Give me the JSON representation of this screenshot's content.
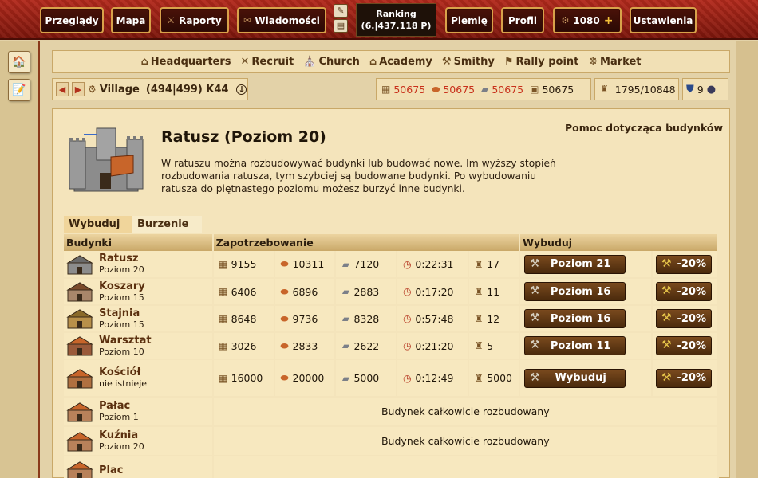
{
  "topbar": {
    "buttons": [
      {
        "label": "Przeglądy"
      },
      {
        "label": "Mapa"
      },
      {
        "label": "Raporty"
      },
      {
        "label": "Wiadomości"
      },
      {
        "label": "Plemię"
      },
      {
        "label": "Profil"
      },
      {
        "label": "1080"
      },
      {
        "label": "Ustawienia"
      }
    ],
    "ranking_label": "Ranking",
    "ranking_value": "(6.|437.118 P)"
  },
  "building_nav": [
    {
      "label": "Headquarters",
      "icon": "headquarters-icon"
    },
    {
      "label": "Recruit",
      "icon": "crossed-swords-icon"
    },
    {
      "label": "Church",
      "icon": "church-icon"
    },
    {
      "label": "Academy",
      "icon": "academy-icon"
    },
    {
      "label": "Smithy",
      "icon": "anvil-icon"
    },
    {
      "label": "Rally point",
      "icon": "flag-icon"
    },
    {
      "label": "Market",
      "icon": "wheel-icon"
    }
  ],
  "village": {
    "name": "Village",
    "coords": "(494|499) K44"
  },
  "resources": {
    "wood": "50675",
    "clay": "50675",
    "iron": "50675",
    "storage": "50675",
    "population": "1795/10848",
    "units": "9"
  },
  "page": {
    "title": "Ratusz (Poziom 20)",
    "help_link": "Pomoc dotycząca budynków",
    "description": "W ratuszu można rozbudowywać budynki lub budować nowe. Im wyższy stopień rozbudowania ratusza, tym szybciej są budowane budynki. Po wybudowaniu ratusza do piętnastego poziomu możesz burzyć inne budynki."
  },
  "tabs": [
    {
      "label": "Wybuduj"
    },
    {
      "label": "Burzenie"
    }
  ],
  "table": {
    "headers": {
      "buildings": "Budynki",
      "requirements": "Zapotrzebowanie",
      "build": "Wybuduj"
    },
    "rows": [
      {
        "name": "Ratusz",
        "level": "Poziom 20",
        "wood": "9155",
        "clay": "10311",
        "iron": "7120",
        "time": "0:22:31",
        "pop": "17",
        "button": "Poziom 21",
        "discount": "-20%"
      },
      {
        "name": "Koszary",
        "level": "Poziom 15",
        "wood": "6406",
        "clay": "6896",
        "iron": "2883",
        "time": "0:17:20",
        "pop": "11",
        "button": "Poziom 16",
        "discount": "-20%"
      },
      {
        "name": "Stajnia",
        "level": "Poziom 15",
        "wood": "8648",
        "clay": "9736",
        "iron": "8328",
        "time": "0:57:48",
        "pop": "12",
        "button": "Poziom 16",
        "discount": "-20%"
      },
      {
        "name": "Warsztat",
        "level": "Poziom 10",
        "wood": "3026",
        "clay": "2833",
        "iron": "2622",
        "time": "0:21:20",
        "pop": "5",
        "button": "Poziom 11",
        "discount": "-20%"
      },
      {
        "name": "Kościół",
        "level": "nie istnieje",
        "wood": "16000",
        "clay": "20000",
        "iron": "5000",
        "time": "0:12:49",
        "pop": "5000",
        "button": "Wybuduj",
        "discount": "-20%"
      }
    ],
    "maxed_rows": [
      {
        "name": "Pałac",
        "level": "Poziom 1",
        "status": "Budynek całkowicie rozbudowany"
      },
      {
        "name": "Kuźnia",
        "level": "Poziom 20",
        "status": "Budynek całkowicie rozbudowany"
      },
      {
        "name": "Plac",
        "level": "",
        "status": ""
      }
    ]
  }
}
